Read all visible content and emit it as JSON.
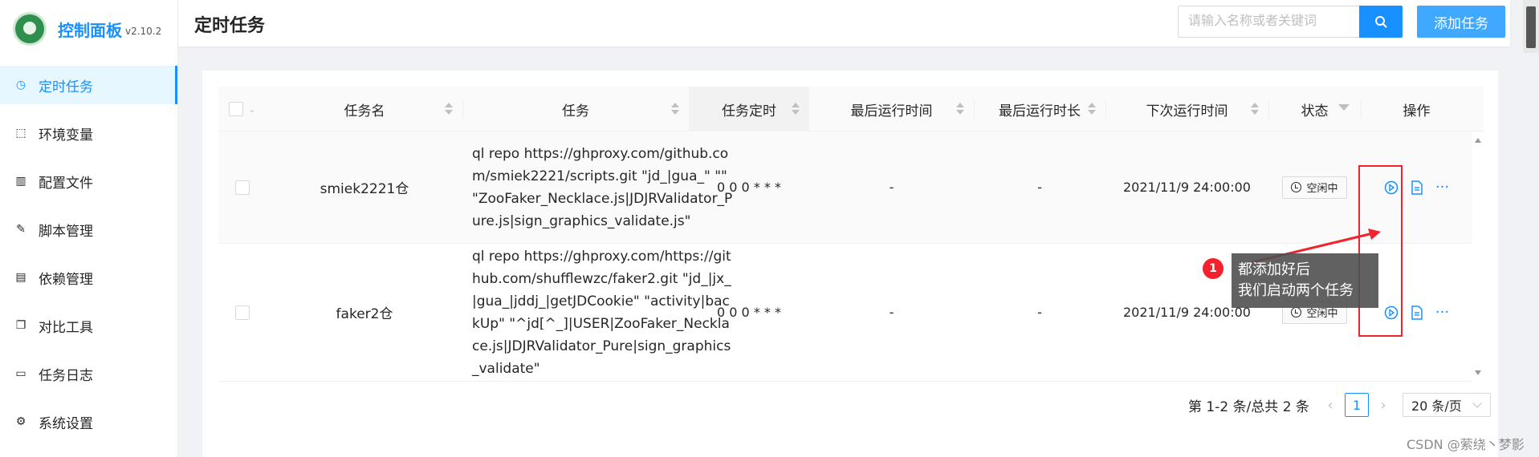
{
  "brand": {
    "title": "控制面板",
    "version": "v2.10.2"
  },
  "sidebar": {
    "items": [
      {
        "label": "定时任务",
        "icon": "clock-icon",
        "active": true
      },
      {
        "label": "环境变量",
        "icon": "dashed-box-icon",
        "active": false
      },
      {
        "label": "配置文件",
        "icon": "chart-box-icon",
        "active": false
      },
      {
        "label": "脚本管理",
        "icon": "edit-icon",
        "active": false
      },
      {
        "label": "依赖管理",
        "icon": "list-box-icon",
        "active": false
      },
      {
        "label": "对比工具",
        "icon": "diff-file-icon",
        "active": false
      },
      {
        "label": "任务日志",
        "icon": "folder-icon",
        "active": false
      },
      {
        "label": "系统设置",
        "icon": "gear-icon",
        "active": false
      }
    ]
  },
  "header": {
    "title": "定时任务",
    "search_placeholder": "请输入名称或者关键词",
    "search_icon": "search-icon",
    "add_label": "添加任务"
  },
  "table": {
    "columns": [
      "任务名",
      "任务",
      "任务定时",
      "最后运行时间",
      "最后运行时长",
      "下次运行时间",
      "状态",
      "操作"
    ],
    "rows": [
      {
        "name": "smiek2221仓",
        "command": "ql repo https://ghproxy.com/github.com/smiek2221/scripts.git \"jd_|gua_\" \"\" \"ZooFaker_Necklace.js|JDJRValidator_Pure.js|sign_graphics_validate.js\"",
        "schedule": "0 0 0 * * *",
        "last_run": "-",
        "last_duration": "-",
        "next_run": "2021/11/9 24:00:00",
        "status": "空闲中"
      },
      {
        "name": "faker2仓",
        "command": "ql repo https://ghproxy.com/https://github.com/shufflewzc/faker2.git \"jd_|jx_|gua_|jddj_|getJDCookie\" \"activity|backUp\" \"^jd[^_]|USER|ZooFaker_Necklace.js|JDJRValidator_Pure|sign_graphics_validate\"",
        "schedule": "0 0 0 * * *",
        "last_run": "-",
        "last_duration": "-",
        "next_run": "2021/11/9 24:00:00",
        "status": "空闲中"
      }
    ]
  },
  "pagination": {
    "total_text": "第 1-2 条/总共 2 条",
    "current_page": "1",
    "prev": "‹",
    "next": "›",
    "page_size": "20 条/页"
  },
  "annotation": {
    "badge": "1",
    "line1": "都添加好后",
    "line2": "我们启动两个任务",
    "highlight_color": "#f5222d"
  },
  "watermark": "CSDN @萦绕丶梦影",
  "colors": {
    "primary": "#1890ff",
    "add_button": "#40a9ff"
  }
}
